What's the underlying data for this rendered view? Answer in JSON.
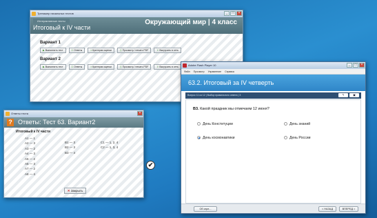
{
  "window_main": {
    "titlebar": "Тренажер начальных тестов",
    "app_tag": "Интерактивные тесты",
    "subject": "Окружающий мир | 4 класс",
    "page_title": "Итоговый к IV части",
    "variants": [
      {
        "title": "Вариант 1",
        "buttons": [
          "Выполнить тест",
          "Ответы",
          "Критерии оценки",
          "Просмотр / печать PDF",
          "Выгрузить в сеть"
        ]
      },
      {
        "title": "Вариант 2",
        "buttons": [
          "Выполнить тест",
          "Ответы",
          "Критерии оценки",
          "Просмотр / печать PDF",
          "Выгрузить в сеть"
        ]
      }
    ]
  },
  "window_answers": {
    "titlebar": "Ответы теста",
    "header_icon": "?",
    "header": "Ответы: Тест 63. Вариант2",
    "subtitle": "Итоговый к IV части",
    "col1": [
      "А1 — 1",
      "А2 — 3",
      "А3 — 2",
      "А4 — 3",
      "А5 — 2",
      "А6 — 3",
      "А7 — 2",
      "А8 — 4"
    ],
    "col2": [
      "В1 — 3",
      "В2 — 3",
      "В3 — 4"
    ],
    "col3": [
      "С1 — 1, 2, 4",
      "С2 — 1, 3, 4"
    ],
    "close_label": "Закрыть"
  },
  "window_player": {
    "titlebar": "Adobe Flash Player 10",
    "menu": [
      "Файл",
      "Просмотр",
      "Управление",
      "Справка"
    ],
    "header": "63.2. Итоговый за IV четверть",
    "breadcrumb": "Вопрос 11 из 12 | Выбор правильного ответа | 3",
    "nav_buttons": [
      "↰",
      "▣"
    ],
    "question_num": "В3.",
    "question_text": "Какой праздник мы отмечаем 12 июня?",
    "options": [
      {
        "label": "День Конституции",
        "selected": false
      },
      {
        "label": "День знаний",
        "selected": false
      },
      {
        "label": "День космонавтики",
        "selected": true
      },
      {
        "label": "День России",
        "selected": false
      }
    ],
    "footer": {
      "about": "Об игре...",
      "prev": "< НАЗАД",
      "next": "ВПЕРЕД >"
    }
  },
  "icons": {
    "check": "✔"
  }
}
